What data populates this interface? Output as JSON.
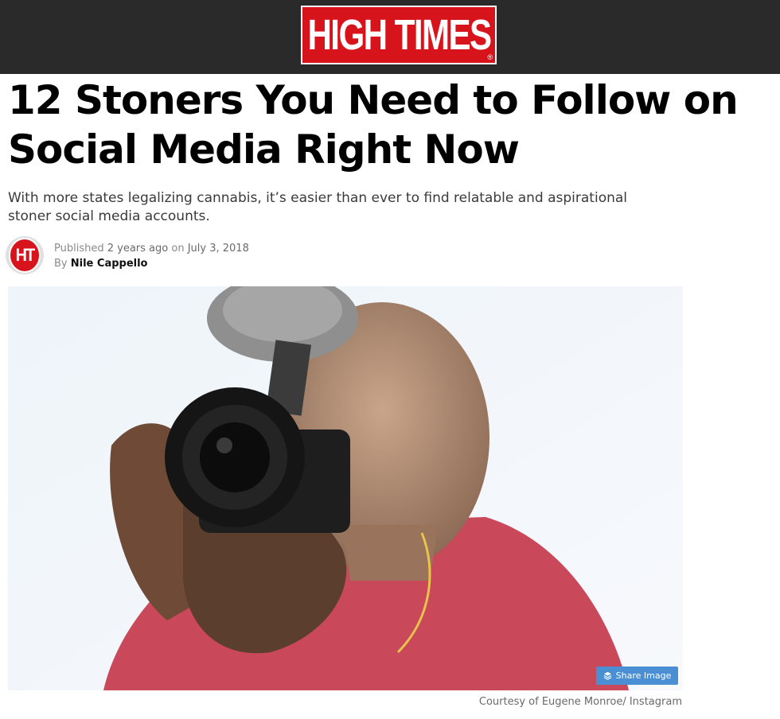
{
  "header": {
    "logo_text": "HIGH TIMES",
    "logo_registered": "®",
    "brand_color": "#d7141c",
    "bar_color": "#2a2a2a"
  },
  "article": {
    "title": "12 Stoners You Need to Follow on Social Media Right Now",
    "subtitle": "With more states legalizing cannabis, it’s easier than ever to find relatable and aspirational stoner social media accounts.",
    "published_label": "Published",
    "published_relative": "2 years ago",
    "published_on_label": "on",
    "published_date": "July 3, 2018",
    "by_label": "By",
    "author": "Nile Cappello",
    "avatar_text": "HT"
  },
  "hero_image": {
    "share_label": "Share Image",
    "share_icon": "layers-icon",
    "caption": "Courtesy of Eugene Monroe/ Instagram",
    "accent_color": "#4a8fd4"
  }
}
